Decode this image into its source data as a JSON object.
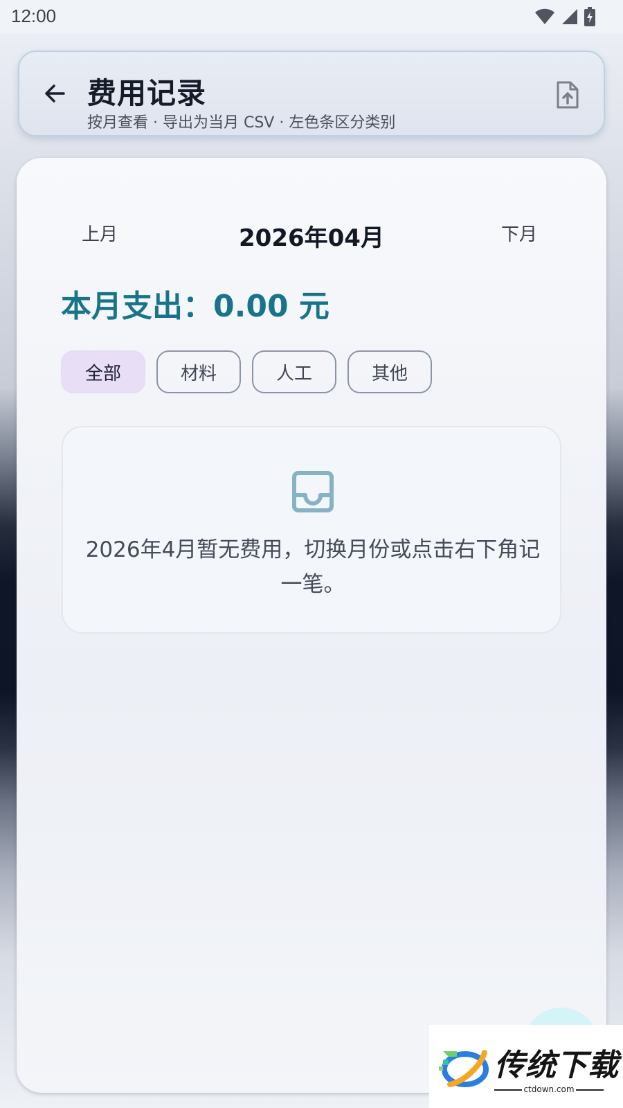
{
  "status_bar": {
    "time": "12:00"
  },
  "header": {
    "title": "费用记录",
    "subtitle": "按月查看 · 导出为当月 CSV · 左色条区分类别",
    "back_icon": "arrow-left-icon",
    "export_icon": "file-upload-icon"
  },
  "month_nav": {
    "prev_label": "上月",
    "current": "2026年04月",
    "next_label": "下月"
  },
  "summary": {
    "total_label": "本月支出：0.00 元"
  },
  "filters": {
    "chips": [
      {
        "label": "全部",
        "selected": true
      },
      {
        "label": "材料",
        "selected": false
      },
      {
        "label": "人工",
        "selected": false
      },
      {
        "label": "其他",
        "selected": false
      }
    ]
  },
  "empty_state": {
    "icon": "inbox-icon",
    "message": "2026年4月暂无费用，切换月份或点击右下角记一笔。"
  },
  "watermark": {
    "brand": "传统下载",
    "domain": "ctdown.com"
  },
  "colors": {
    "accent": "#177489",
    "selected_chip": "#e8dff6",
    "header_border": "#b9d3e4",
    "fab": "#d4f4f8"
  }
}
